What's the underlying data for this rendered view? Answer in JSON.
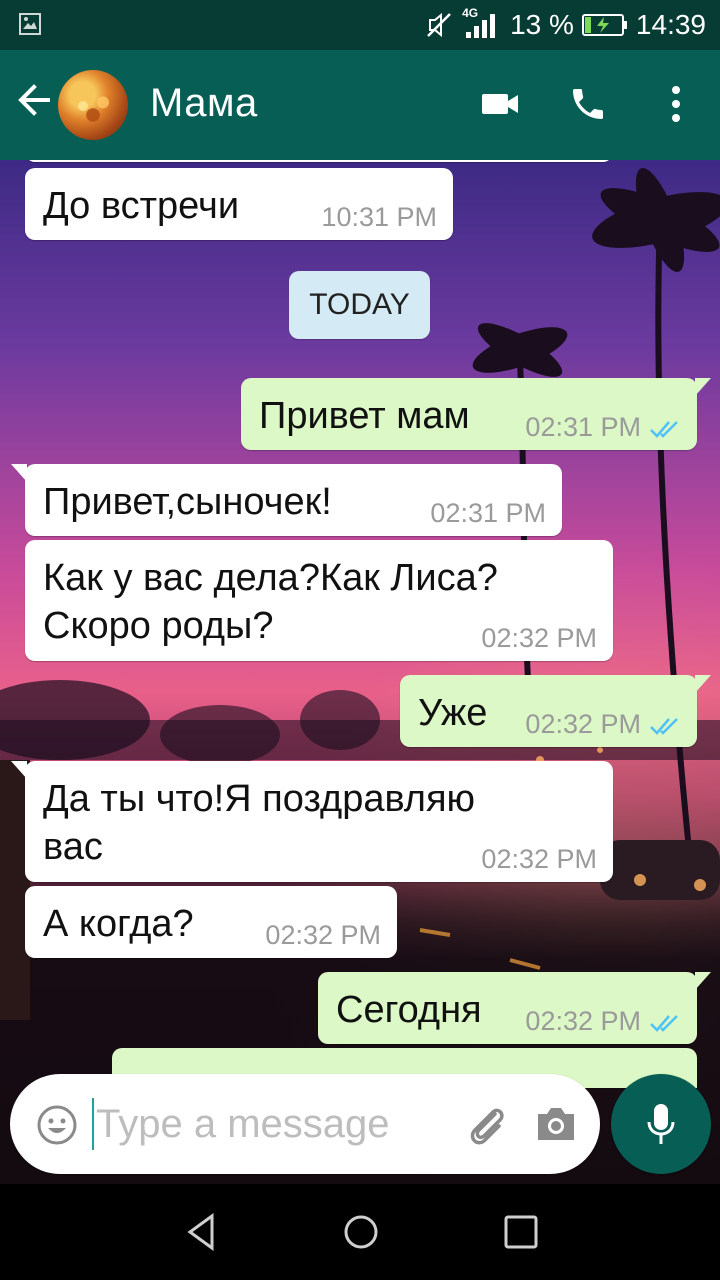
{
  "status_bar": {
    "network": "4G",
    "battery": "13 %",
    "time": "14:39"
  },
  "header": {
    "contact_name": "Мама"
  },
  "messages": [
    {
      "direction": "in",
      "text": "До встречи",
      "time": "10:31 PM"
    },
    {
      "direction": "out",
      "text": "Привет мам",
      "time": "02:31 PM",
      "read": true
    },
    {
      "direction": "in",
      "text": "Привет,сыночек!",
      "time": "02:31 PM"
    },
    {
      "direction": "in",
      "text_lines": [
        "Как у вас дела?Как Лиса?",
        "Скоро роды?"
      ],
      "time": "02:32 PM"
    },
    {
      "direction": "out",
      "text": "Уже",
      "time": "02:32 PM",
      "read": true
    },
    {
      "direction": "in",
      "text_lines": [
        "Да ты что!Я поздравляю",
        "вас"
      ],
      "time": "02:32 PM"
    },
    {
      "direction": "in",
      "text": "А когда?",
      "time": "02:32 PM"
    },
    {
      "direction": "out",
      "text": "Сегодня",
      "time": "02:32 PM",
      "read": true
    }
  ],
  "date_divider": "TODAY",
  "composer": {
    "placeholder": "Type a message"
  },
  "icons": {
    "back": "arrow-left-icon",
    "video": "video-call-icon",
    "call": "phone-icon",
    "menu": "more-vert-icon",
    "emoji": "emoji-icon",
    "attach": "paperclip-icon",
    "camera": "camera-icon",
    "mic": "mic-icon"
  },
  "colors": {
    "header": "#075e54",
    "statusbar": "#063c33",
    "outgoing_bubble": "#dcf8c6",
    "incoming_bubble": "#ffffff",
    "read_ticks": "#4fc3f7"
  }
}
